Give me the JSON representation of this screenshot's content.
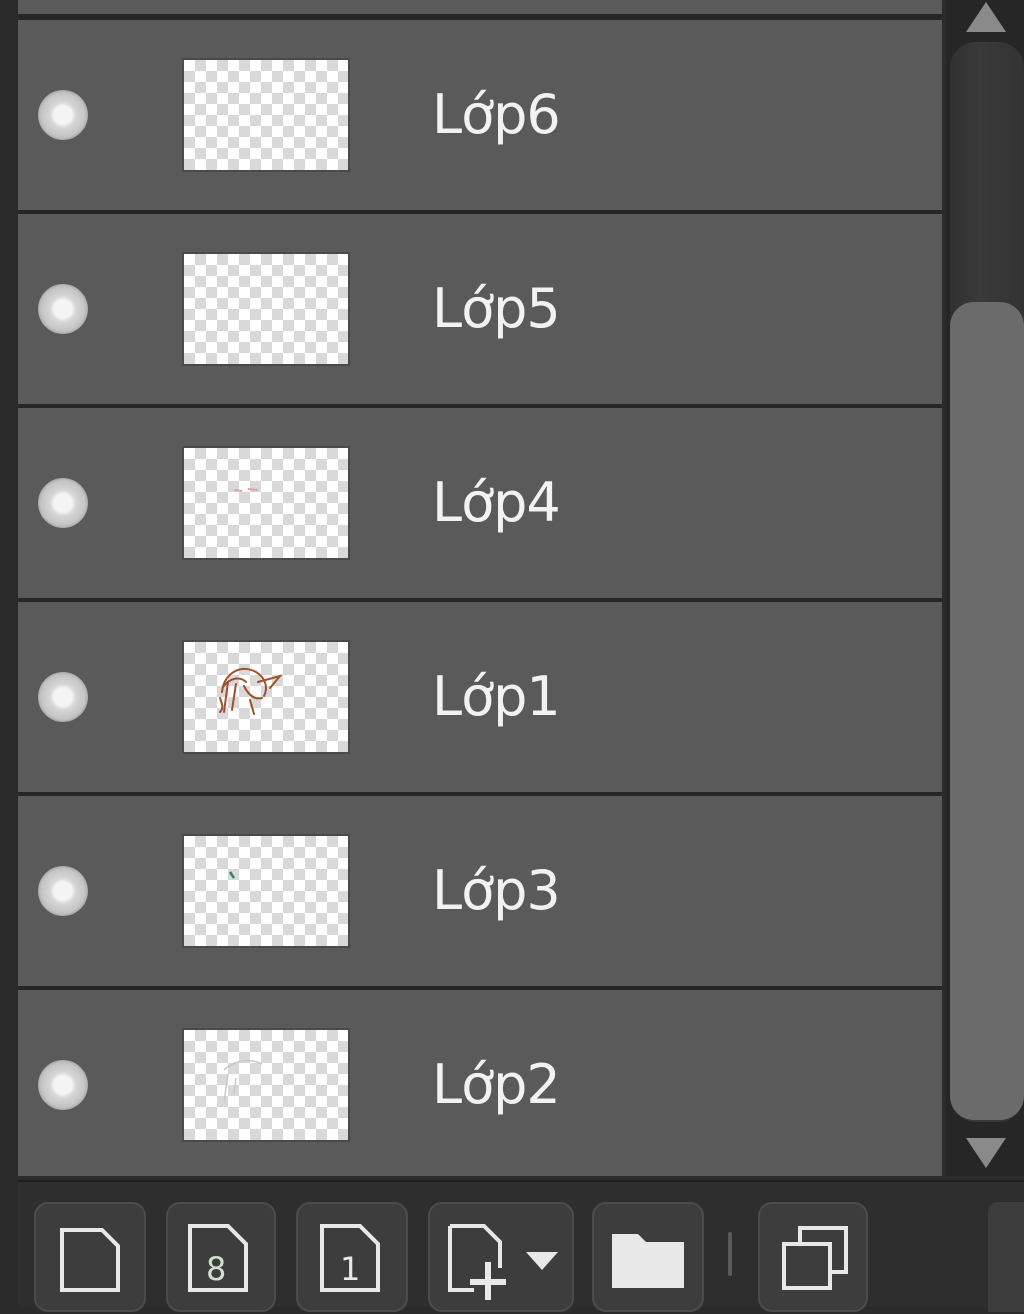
{
  "layers": [
    {
      "name": "Lớp6",
      "thumbnail": "empty"
    },
    {
      "name": "Lớp5",
      "thumbnail": "empty"
    },
    {
      "name": "Lớp4",
      "thumbnail": "faint-marks"
    },
    {
      "name": "Lớp1",
      "thumbnail": "sketch"
    },
    {
      "name": "Lớp3",
      "thumbnail": "tiny-mark"
    },
    {
      "name": "Lớp2",
      "thumbnail": "faint-sketch"
    }
  ],
  "toolbar": {
    "buttons": [
      {
        "icon": "new-layer-icon"
      },
      {
        "icon": "new-8bit-layer-icon",
        "glyph": "8"
      },
      {
        "icon": "new-1bit-layer-icon",
        "glyph": "1"
      },
      {
        "icon": "add-layer-dropdown-icon"
      },
      {
        "icon": "folder-icon"
      },
      {
        "icon": "duplicate-layer-icon"
      }
    ]
  },
  "colors": {
    "row_bg": "#5a5a5a",
    "panel_bg": "#262626",
    "text": "#f2f2f2",
    "sketch": "#a0502c"
  }
}
